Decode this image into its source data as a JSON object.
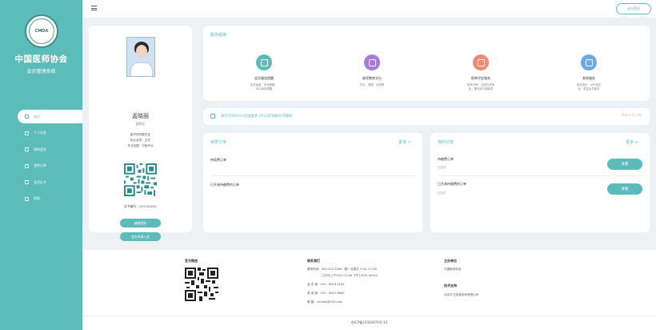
{
  "sidebar": {
    "org_name": "中国医师协会",
    "org_sub": "会员管理系统",
    "items": [
      {
        "label": "首页",
        "active": true
      },
      {
        "label": "个人信息"
      },
      {
        "label": "我的会员"
      },
      {
        "label": "我的订单"
      },
      {
        "label": "会员证书"
      },
      {
        "label": "帮助"
      }
    ]
  },
  "topbar": {
    "logout": "退出登录"
  },
  "profile": {
    "name": "孟晓丽",
    "title": "副院长",
    "lines": [
      "医疗机构委员会",
      "执业会员：主任",
      "专业范围：中医专业"
    ],
    "cert_no": "证书编号：201700034",
    "btn_primary": "编辑资料",
    "btn_secondary": "会员申请入会"
  },
  "services": {
    "title": "服务超链",
    "items": [
      {
        "name": "会员服务提醒",
        "desc": "会员续费、申请提醒、\n待办事宜提醒",
        "color": "#5bbcba"
      },
      {
        "name": "继续教育学分",
        "desc": "学分、课程、讲座等",
        "color": "#a77bdb"
      },
      {
        "name": "职称评定服务",
        "desc": "职称评审，证明开具等\n及，需内部沟通事项",
        "color": "#ef8a76"
      },
      {
        "name": "其他服务",
        "desc": "报名登记，APP相关\n及，权益会员服务",
        "color": "#6aa8e8"
      }
    ]
  },
  "notice": {
    "text": "关于召开2023全国医师 2023年会报名的通知",
    "date": "2023-12-20"
  },
  "renew": {
    "title": "续费订单",
    "more": "更多 >",
    "rows": [
      {
        "label": "待续费订单"
      },
      {
        "label": "已开具待缴费的订单"
      }
    ]
  },
  "orders": {
    "title": "我的订单",
    "more": "更多 >",
    "rows": [
      {
        "label": "待缴费订单",
        "status": "已支付",
        "btn": "查看"
      },
      {
        "label": "已开具待缴费的订单",
        "status": "已支付",
        "btn": "查看"
      }
    ]
  },
  "footer": {
    "qr_title": "官方微信",
    "contact_title": "联系我们",
    "contact_lines": [
      "服务热线：400-012-3306（周一至周五 9:00-17:00）",
      "（工作日上午9:00-12:00 下午14:00-18:00）",
      "会  员  部：010 - 8918 5181",
      "咨  询  部：010 - 8591 8662",
      "邮      箱：cmdafy@163.com"
    ],
    "host_title": "主办单位",
    "host_name": "中国医师协会",
    "support_title": "技术支持",
    "support_name": "北京华卫信息技术有限公司"
  },
  "copyright": "京ICP备15024470号-10"
}
